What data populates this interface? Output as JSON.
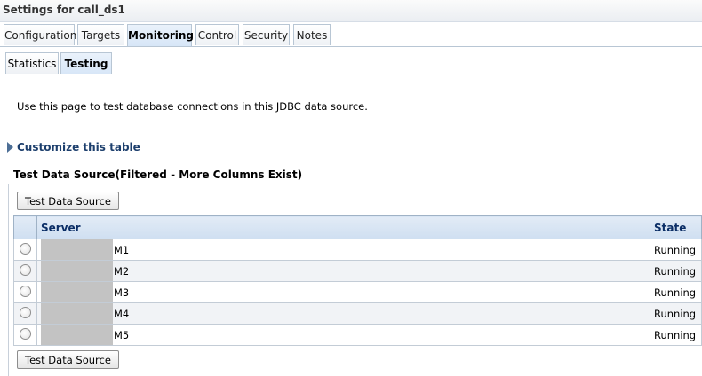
{
  "window": {
    "title": "Settings for call_ds1"
  },
  "tabs": [
    {
      "label": "Configuration",
      "active": false
    },
    {
      "label": "Targets",
      "active": false
    },
    {
      "label": "Monitoring",
      "active": true
    },
    {
      "label": "Control",
      "active": false
    },
    {
      "label": "Security",
      "active": false
    },
    {
      "label": "Notes",
      "active": false
    }
  ],
  "subtabs": [
    {
      "label": "Statistics",
      "active": false
    },
    {
      "label": "Testing",
      "active": true
    }
  ],
  "intro_text": "Use this page to test database connections in this JDBC data source.",
  "customize_link": "Customize this table",
  "table_title": "Test Data Source(Filtered - More Columns Exist)",
  "test_button_label": "Test Data Source",
  "table": {
    "columns": [
      "Server",
      "State"
    ],
    "rows": [
      {
        "server_suffix": "M1",
        "state": "Running"
      },
      {
        "server_suffix": "M2",
        "state": "Running"
      },
      {
        "server_suffix": "M3",
        "state": "Running"
      },
      {
        "server_suffix": "M4",
        "state": "Running"
      },
      {
        "server_suffix": "M5",
        "state": "Running"
      }
    ]
  },
  "colors": {
    "header_text": "#0b2e66",
    "link": "#1d3f6d",
    "active_tab_bg": "#d7e6f7"
  }
}
